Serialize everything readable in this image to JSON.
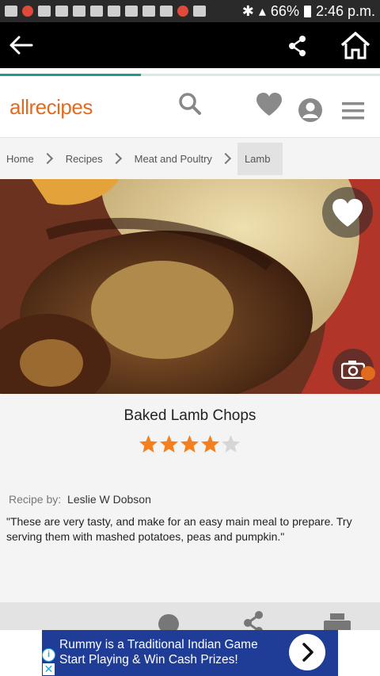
{
  "status_bar": {
    "battery": "66%",
    "time": "2:46 p.m."
  },
  "app_bar": {
    "back_icon": "arrow-left-icon",
    "share_icon": "share-icon",
    "home_icon": "home-icon"
  },
  "page_load_progress": 0.37,
  "header": {
    "logo": "allrecipes",
    "search_icon": "search-icon",
    "favorites_icon": "heart-icon",
    "profile_icon": "user-avatar-icon",
    "menu_icon": "hamburger-menu-icon"
  },
  "breadcrumb": [
    "Home",
    "Recipes",
    "Meat and Poultry",
    "Lamb"
  ],
  "recipe": {
    "title": "Baked Lamb Chops",
    "rating": 4,
    "rating_max": 5,
    "recipe_by_label": "Recipe by:",
    "author": "Leslie W Dobson",
    "description": "\"These are very tasty, and make for an easy main meal to prepare. Try serving them with mashed potatoes, peas and pumpkin.\""
  },
  "toolbar": {
    "icons": [
      "location-pin-icon",
      "share-icon",
      "print-icon"
    ]
  },
  "ad": {
    "line1": "Rummy is a Traditional Indian Game",
    "line2": "Start Playing & Win Cash Prizes!",
    "info_icon": "info-icon",
    "close_icon": "close-icon"
  },
  "colors": {
    "brand_orange": "#e36b1e",
    "star_filled": "#f47f20",
    "star_empty": "#d6d6d6",
    "progress": "#1aa08a",
    "ad_blue": "#1f3d96"
  }
}
